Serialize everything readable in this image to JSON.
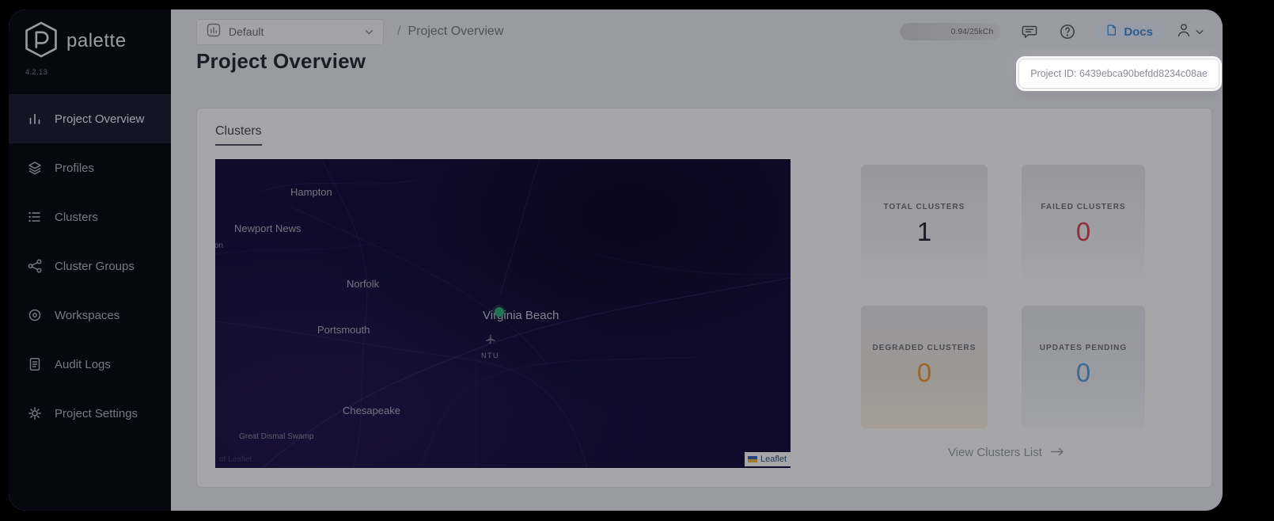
{
  "app": {
    "name": "palette",
    "version": "4.2.13"
  },
  "sidebar": {
    "items": [
      {
        "label": "Project Overview"
      },
      {
        "label": "Profiles"
      },
      {
        "label": "Clusters"
      },
      {
        "label": "Cluster Groups"
      },
      {
        "label": "Workspaces"
      },
      {
        "label": "Audit Logs"
      },
      {
        "label": "Project Settings"
      }
    ]
  },
  "topbar": {
    "project_selector": {
      "value": "Default"
    },
    "breadcrumb": {
      "separator": "/",
      "current": "Project Overview"
    },
    "usage_badge": "0.94/25kCh",
    "docs_button": "Docs"
  },
  "page": {
    "title": "Project Overview",
    "project_id_tooltip": "Project ID: 6439ebca90befdd8234c08ae"
  },
  "clusters": {
    "heading": "Clusters",
    "map": {
      "labels": {
        "hampton": "Hampton",
        "newport_news": "Newport News",
        "lton": "lton",
        "norfolk": "Norfolk",
        "virginia_beach": "Virginia Beach",
        "portsmouth": "Portsmouth",
        "ntu": "NTU",
        "chesapeake": "Chesapeake",
        "great_dismal_swamp": "Great Dismal Swamp"
      },
      "attribution": "Leaflet",
      "attribution_left": "of Leaflet",
      "marker_color": "#35b27c"
    },
    "stats": [
      {
        "label": "TOTAL CLUSTERS",
        "value": "1",
        "color": "#262838"
      },
      {
        "label": "FAILED CLUSTERS",
        "value": "0",
        "color": "#e0485a"
      },
      {
        "label": "DEGRADED CLUSTERS",
        "value": "0",
        "color": "#ec9c3e"
      },
      {
        "label": "UPDATES PENDING",
        "value": "0",
        "color": "#64a0d8"
      }
    ],
    "view_link": "View Clusters List"
  }
}
